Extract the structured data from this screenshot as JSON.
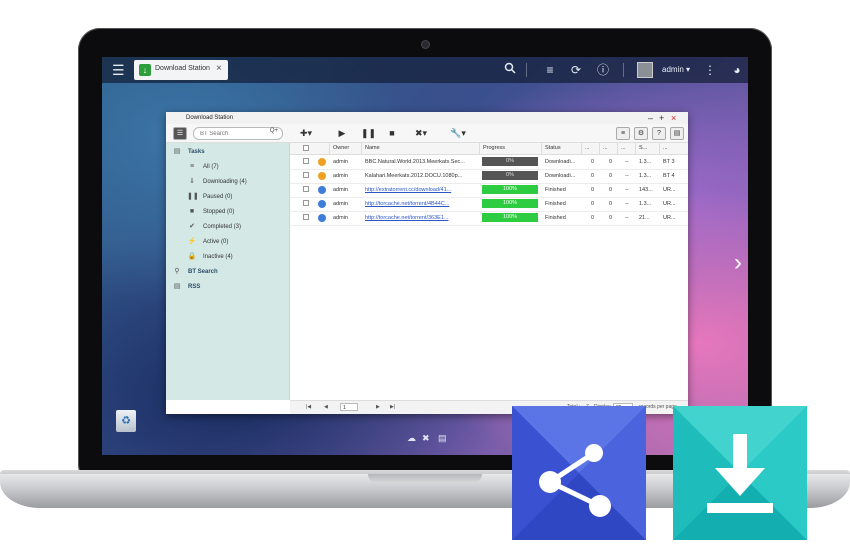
{
  "taskbar": {
    "tab_label": "Download Station",
    "username": "admin",
    "icons": [
      "menu-icon",
      "search-icon",
      "stack-icon",
      "sync-icon",
      "info-icon",
      "more-icon",
      "gauge-icon"
    ]
  },
  "window": {
    "title": "Download Station",
    "search_placeholder": "BT Search"
  },
  "sidebar": {
    "tasks_header": "Tasks",
    "items": [
      {
        "label": "All (7)",
        "icon": "list-icon"
      },
      {
        "label": "Downloading (4)",
        "icon": "download-icon"
      },
      {
        "label": "Paused (0)",
        "icon": "pause-icon"
      },
      {
        "label": "Stopped (0)",
        "icon": "stop-icon"
      },
      {
        "label": "Completed (3)",
        "icon": "check-icon"
      },
      {
        "label": "Active (0)",
        "icon": "bolt-icon"
      },
      {
        "label": "Inactive (4)",
        "icon": "lock-icon"
      }
    ],
    "bt_search": "BT Search",
    "rss": "RSS"
  },
  "table": {
    "columns": [
      "Owner",
      "Name",
      "Progress",
      "Status",
      "...",
      "...",
      "...",
      "S...",
      "..."
    ],
    "rows": [
      {
        "owner": "admin",
        "name": "BBC.Natural.World.2013.Meerkats.Sec...",
        "progress": "0%",
        "progress_value": 0,
        "status": "Downloadi...",
        "c1": "0",
        "c2": "0",
        "c3": "--",
        "c4": "1.3...",
        "c5": "BT 3",
        "link": false,
        "state": "downloading"
      },
      {
        "owner": "admin",
        "name": "Kalahari.Meerkats.2012.DOCU.1080p...",
        "progress": "0%",
        "progress_value": 0,
        "status": "Downloadi...",
        "c1": "0",
        "c2": "0",
        "c3": "--",
        "c4": "1.3...",
        "c5": "BT 4",
        "link": false,
        "state": "downloading"
      },
      {
        "owner": "admin",
        "name": "http://extratorrent.cc/download/41...",
        "progress": "100%",
        "progress_value": 100,
        "status": "Finished",
        "c1": "0",
        "c2": "0",
        "c3": "--",
        "c4": "143...",
        "c5": "UR...",
        "link": true,
        "state": "finished"
      },
      {
        "owner": "admin",
        "name": "http://torcache.net/torrent/4B44C...",
        "progress": "100%",
        "progress_value": 100,
        "status": "Finished",
        "c1": "0",
        "c2": "0",
        "c3": "--",
        "c4": "1.3...",
        "c5": "UR...",
        "link": true,
        "state": "finished"
      },
      {
        "owner": "admin",
        "name": "http://torcache.net/torrent/363E1...",
        "progress": "100%",
        "progress_value": 100,
        "status": "Finished",
        "c1": "0",
        "c2": "0",
        "c3": "--",
        "c4": "21...",
        "c5": "UR...",
        "link": true,
        "state": "finished"
      }
    ]
  },
  "footer": {
    "page": "1",
    "total_label": "Total :",
    "total_value": "7",
    "display_label": "Display",
    "display_value": "25",
    "records_label": "records per page."
  },
  "colors": {
    "progress_green": "#2ecc40",
    "progress_gray": "#555555",
    "tile_share": "#4259d8",
    "tile_download": "#21c4c0"
  }
}
